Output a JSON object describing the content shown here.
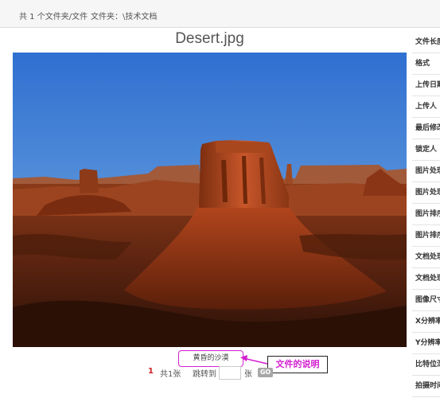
{
  "header": {
    "item_count": "共 1 个文件夹/文件",
    "folder_path": "文件夹：\\技术文档"
  },
  "file": {
    "title": "Desert.jpg",
    "caption": "黄昏的沙漠",
    "callout_label": "文件的说明"
  },
  "pager": {
    "current_page": "1",
    "total_label": "共1张",
    "jump_label": "跳转到",
    "input_value": "",
    "unit_label": "张",
    "go_label": "GO"
  },
  "properties": {
    "items": [
      {
        "label": "文件长度"
      },
      {
        "label": "格式"
      },
      {
        "label": "上传日期"
      },
      {
        "label": "上传人"
      },
      {
        "label": "最后修改"
      },
      {
        "label": "锁定人"
      },
      {
        "label": "图片处理"
      },
      {
        "label": "图片处理"
      },
      {
        "label": "图片排序"
      },
      {
        "label": "图片排序"
      },
      {
        "label": "文档处理"
      },
      {
        "label": "文档处理"
      },
      {
        "label": "图像尺寸"
      },
      {
        "label": "X分辨率"
      },
      {
        "label": "Y分辨率"
      },
      {
        "label": "比特位深"
      },
      {
        "label": "拍摄时间"
      }
    ]
  },
  "colors": {
    "highlight": "#d31fd0",
    "current_page": "#cc2222"
  }
}
